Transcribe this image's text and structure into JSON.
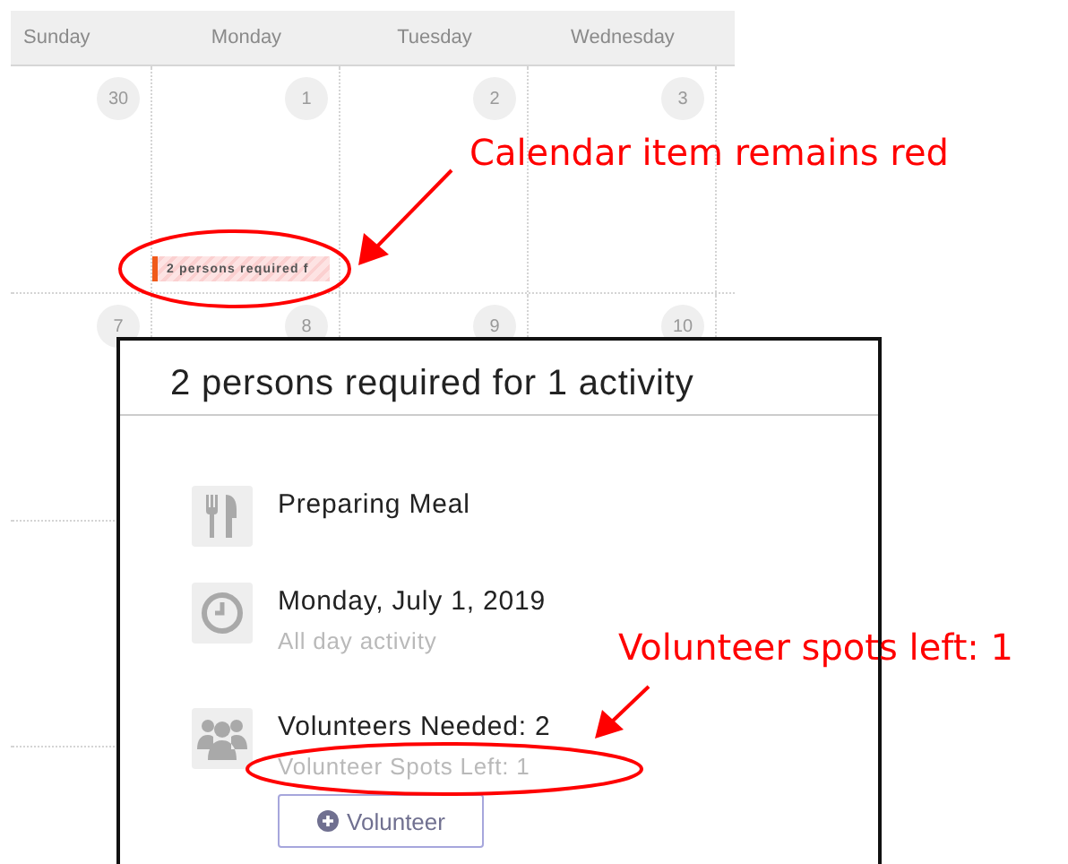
{
  "calendar": {
    "weekdays": [
      "Sunday",
      "Monday",
      "Tuesday",
      "Wednesday"
    ],
    "weeks": [
      {
        "days": [
          {
            "number": "30"
          },
          {
            "number": "1",
            "events": [
              {
                "label": "2 persons required f",
                "color": "#f05a1a"
              }
            ]
          },
          {
            "number": "2"
          },
          {
            "number": "3"
          }
        ]
      },
      {
        "days": [
          {
            "number": "7"
          },
          {
            "number": "8"
          },
          {
            "number": "9"
          },
          {
            "number": "10"
          }
        ]
      }
    ]
  },
  "popup": {
    "title": "2 persons required for 1 activity",
    "rows": [
      {
        "kind": "meal",
        "title": "Preparing Meal"
      },
      {
        "kind": "date",
        "title": "Monday, July 1, 2019",
        "subtitle": "All day activity"
      },
      {
        "kind": "volunteers",
        "title": "Volunteers Needed: 2",
        "subtitle": "Volunteer Spots Left: 1",
        "button": "Volunteer"
      }
    ]
  },
  "annotations": [
    {
      "text": "Calendar item remains red"
    },
    {
      "text": "Volunteer spots left: 1"
    }
  ]
}
